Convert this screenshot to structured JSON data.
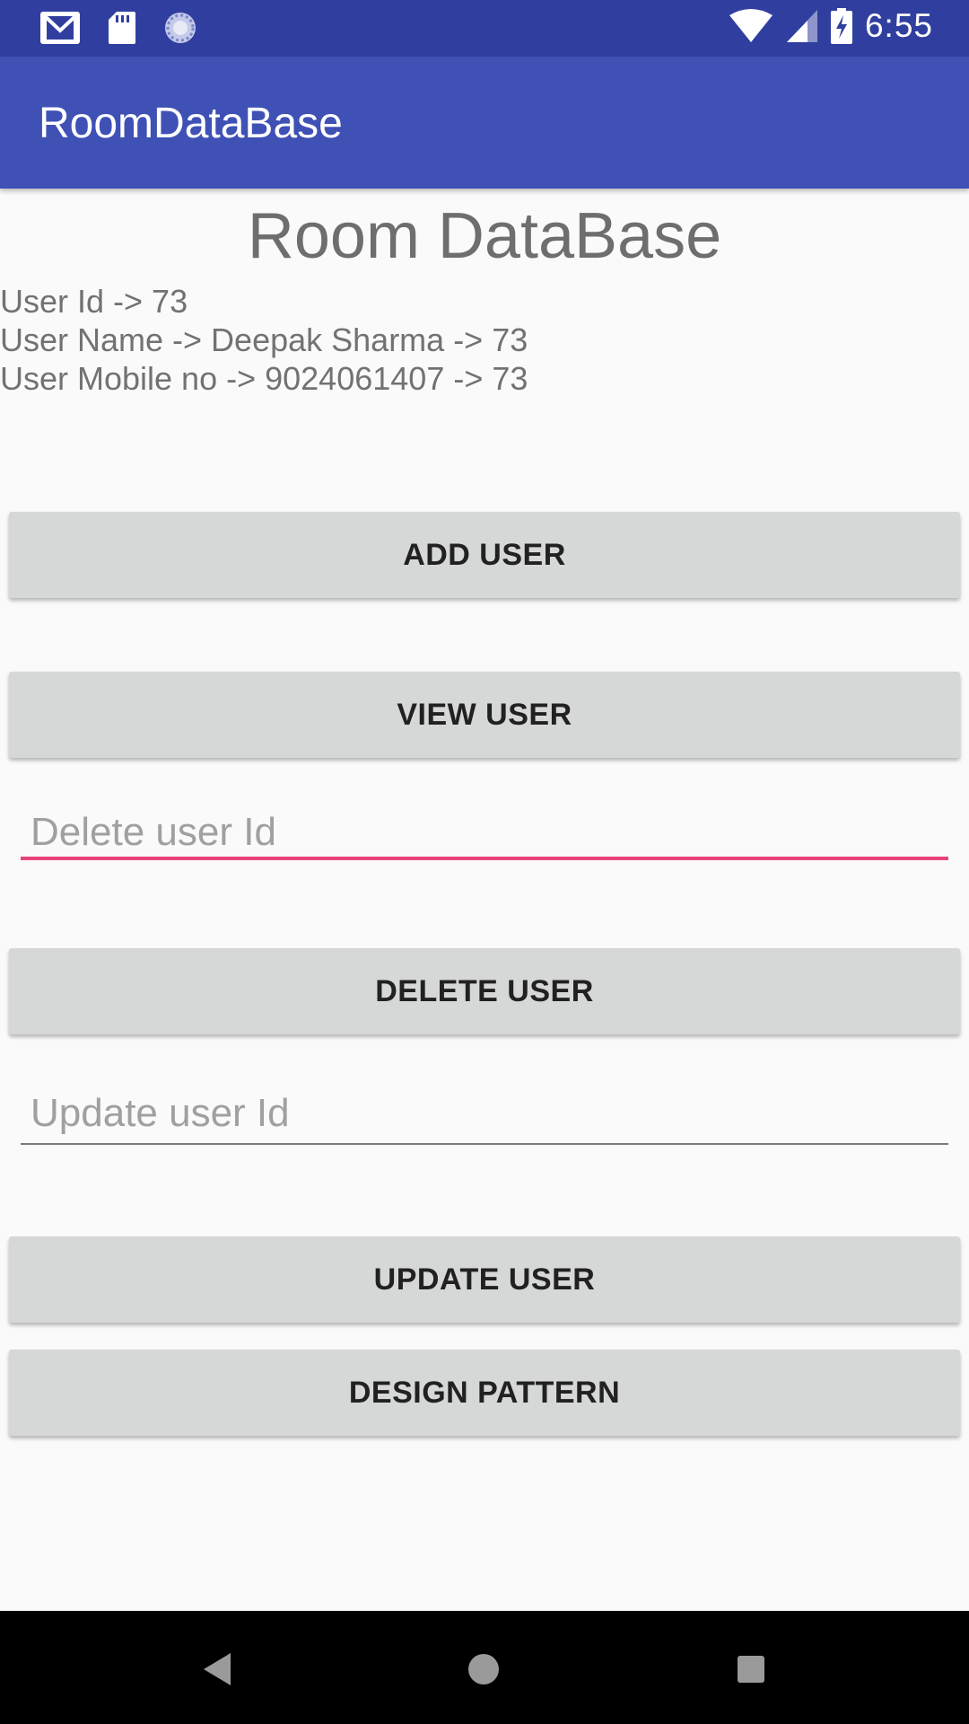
{
  "status_bar": {
    "time": "6:55",
    "left_icons": [
      "gmail-icon",
      "sd-card-icon",
      "sync-progress-icon"
    ],
    "right_icons": [
      "wifi-icon",
      "cell-signal-icon",
      "battery-charging-icon"
    ],
    "background_color": "#303f9f"
  },
  "app_bar": {
    "title": "RoomDataBase",
    "background_color": "#3f51b5"
  },
  "main": {
    "heading": "Room DataBase",
    "user_id_text": "User Id -> 73",
    "user_name_text": "User Name -> Deepak Sharma -> 73",
    "user_mobile_text": "User Mobile no -> 9024061407 -> 73",
    "add_user_label": "ADD USER",
    "view_user_label": "VIEW USER",
    "delete_field": {
      "value": "",
      "placeholder": "Delete user Id",
      "focused_underline_color": "#e8437a"
    },
    "delete_user_label": "DELETE USER",
    "update_field": {
      "value": "",
      "placeholder": "Update user Id"
    },
    "update_user_label": "UPDATE USER",
    "design_pattern_label": "DESIGN PATTERN"
  },
  "nav_bar": {
    "icons": [
      "back-icon",
      "home-icon",
      "recents-icon"
    ]
  }
}
